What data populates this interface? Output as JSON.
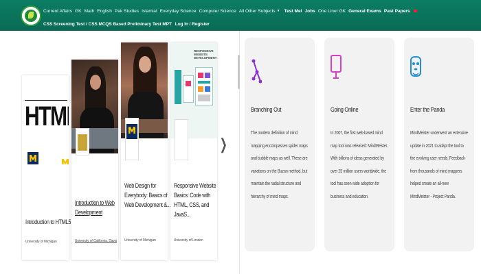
{
  "nav": {
    "row1": [
      {
        "label": "Current Affairs",
        "bold": false
      },
      {
        "label": "GK",
        "bold": false
      },
      {
        "label": "Math",
        "bold": false
      },
      {
        "label": "English",
        "bold": false
      },
      {
        "label": "Pak Studies",
        "bold": false
      },
      {
        "label": "Islamiat",
        "bold": false
      },
      {
        "label": "Everyday Science",
        "bold": false
      },
      {
        "label": "Computer Science",
        "bold": false
      },
      {
        "label": "All Other Subjects",
        "bold": false,
        "dropdown": true
      },
      {
        "label": "Test Mel",
        "bold": true
      },
      {
        "label": "Jobs",
        "bold": true
      },
      {
        "label": "One Liner GK",
        "bold": false
      },
      {
        "label": "General Exams",
        "bold": true
      },
      {
        "label": "Past Papers",
        "bold": true
      }
    ],
    "row2": "CSS Screening Test / CSS MCQS Based Preliminary Test MPT",
    "row2_login": "Log In / Register",
    "accent_color": "#0b7d63"
  },
  "courses": [
    {
      "title": "Introduction to HTML5",
      "institution": "University of Michigan",
      "thumb": "html"
    },
    {
      "title": "Introduction to Web Development",
      "institution": "University of California, Davis",
      "thumb": "photo1"
    },
    {
      "title": "Web Design for Everybody: Basics of Web Development &...",
      "institution": "University of Michigan",
      "thumb": "photo2"
    },
    {
      "title": "Responsive Website Basics: Code with HTML, CSS, and JavaS...",
      "institution": "University of London",
      "thumb": "web"
    }
  ],
  "carousel": {
    "next_icon": "chevron-right-icon"
  },
  "features": [
    {
      "title": "Branching Out",
      "icon": "branch-icon",
      "color": "#8b2fd6",
      "body": "The modern definition of mind mapping encompasses spider maps and bubble maps as well. These are variations on the Buzan method, but maintain the radial structure and hierarchy of mind maps."
    },
    {
      "title": "Going Online",
      "icon": "monitor-icon",
      "color": "#d63fbf",
      "body": "In 2007, the first web-based mind map tool was released: MindMeister. With billions of ideas generated by over 25 million users worldwide, the tool has seen wide adoption for business and education."
    },
    {
      "title": "Enter the Panda",
      "icon": "panda-icon",
      "color": "#1f8fd6",
      "body": "MindMeister underwent an extensive update in 2021 to adapt the tool to the evolving user needs. Feedback from thousands of mind mappers helped create an all-new MindMeister - Project Panda."
    }
  ]
}
